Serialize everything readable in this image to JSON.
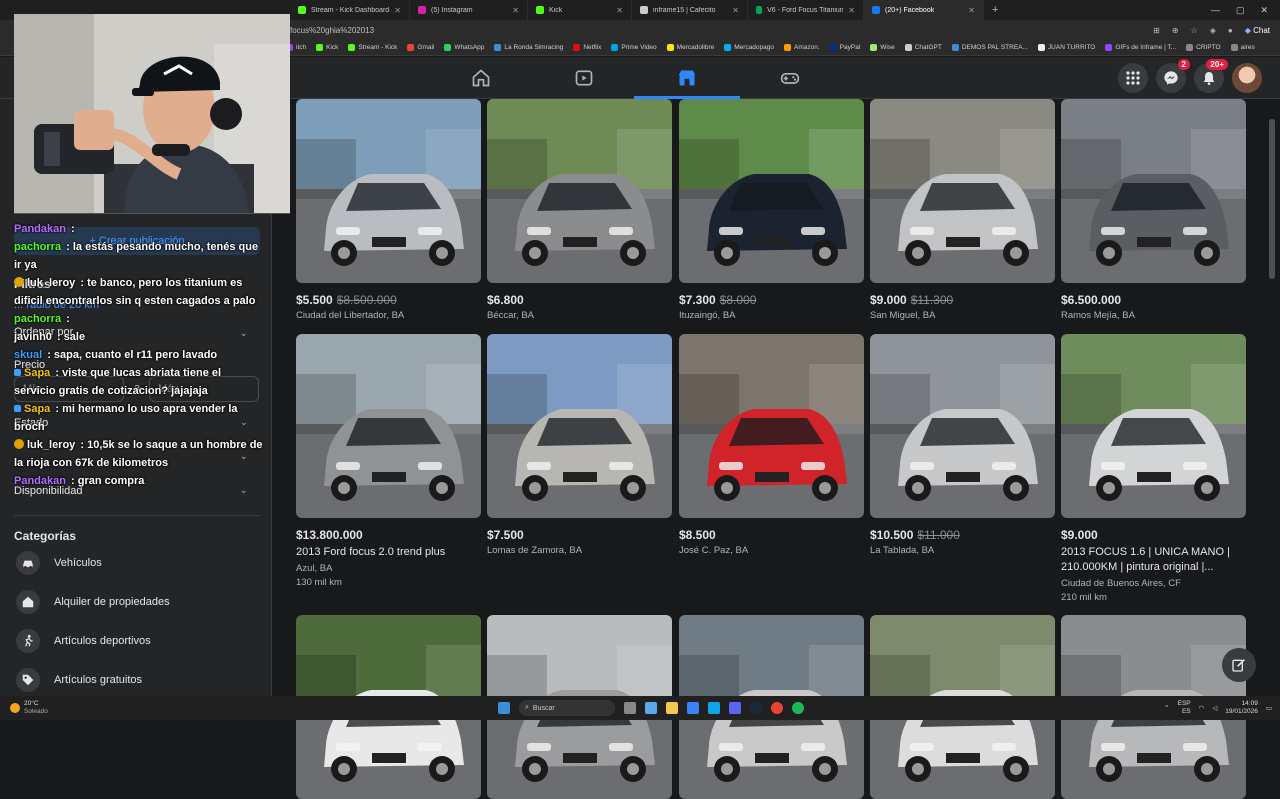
{
  "tabs": [
    {
      "label": "Stream - Kick Dashboard",
      "color": "#53fc18"
    },
    {
      "label": "(5) Instagram",
      "color": "#d6249f"
    },
    {
      "label": "Kick",
      "color": "#53fc18"
    },
    {
      "label": "inframe15 | Cafecito",
      "color": "#cccccc"
    },
    {
      "label": "V6 - Ford Focus Titanium MT 5p",
      "color": "#00a650"
    },
    {
      "label": "(20+) Facebook",
      "color": "#1877f2"
    }
  ],
  "address_bar": {
    "url_fragment": "focus%20ghia%202013"
  },
  "bookmarks": [
    {
      "label": "itch",
      "color": "#9146ff"
    },
    {
      "label": "Kick",
      "color": "#53fc18"
    },
    {
      "label": "Stream - Kick",
      "color": "#53fc18"
    },
    {
      "label": "Gmail",
      "color": "#ea4335"
    },
    {
      "label": "WhatsApp",
      "color": "#25d366"
    },
    {
      "label": "La Ronda Simracing",
      "color": "#3a8fd8"
    },
    {
      "label": "Netflix",
      "color": "#e50914"
    },
    {
      "label": "Prime Video",
      "color": "#00a8e1"
    },
    {
      "label": "Mercadolibre",
      "color": "#ffe600"
    },
    {
      "label": "Mercadopago",
      "color": "#00b1ea"
    },
    {
      "label": "Amazon.",
      "color": "#ff9900"
    },
    {
      "label": "PayPal",
      "color": "#003087"
    },
    {
      "label": "Wise",
      "color": "#9fe870"
    },
    {
      "label": "ChatGPT",
      "color": "#cccccc"
    },
    {
      "label": "DEMOS PAL STREA...",
      "color": "#3a8fd8"
    },
    {
      "label": "JUAN TURRITO",
      "color": "#eeeeee"
    },
    {
      "label": "GIFs de Inframe | T...",
      "color": "#9146ff"
    },
    {
      "label": "CRIPTO",
      "color": "#888888"
    },
    {
      "label": "aires",
      "color": "#888888"
    }
  ],
  "messenger_badge": "2",
  "notifications_badge": "20+",
  "chrome_chat_label": "Chat",
  "sidebar": {
    "create_listing": "+ Crear publicación",
    "filters_heading": "Filtros",
    "radius_prefix": "...",
    "radius": "radio de 20 km",
    "sort_label": "Ordenar por",
    "price_label": "Precio",
    "min_placeholder": "Mín.",
    "to_word": "a",
    "max_placeholder": "Máx.",
    "state_label": "Estado",
    "availability_label": "Disponibilidad",
    "categories_heading": "Categorías",
    "categories": [
      {
        "label": "Vehículos",
        "icon": "car-icon"
      },
      {
        "label": "Alquiler de propiedades",
        "icon": "house-icon"
      },
      {
        "label": "Artículos deportivos",
        "icon": "runner-icon"
      },
      {
        "label": "Artículos gratuitos",
        "icon": "tag-icon"
      }
    ]
  },
  "chat": [
    {
      "user": "Pandakan",
      "color": "#b86bff",
      "text": ""
    },
    {
      "user": "pachorra",
      "color": "#53fc18",
      "text": "la estás pesando mucho, tenés que ir ya"
    },
    {
      "user": "luk_leroy",
      "color": "#ffffff",
      "badge": "mod",
      "text": "te banco, pero los titanium es dificil encontrarlos sin q esten cagados a palo"
    },
    {
      "user": "pachorra",
      "color": "#53fc18",
      "text": ""
    },
    {
      "user": "javinh0",
      "color": "#ffffff",
      "text": "sale"
    },
    {
      "user": "skual",
      "color": "#3aa0ff",
      "text": "sapa, cuanto el r11 pero lavado"
    },
    {
      "user": "Sapa",
      "color": "#f5c518",
      "badge": "kick",
      "text": "viste que lucas abriata tiene el servicio gratis de cotizacion? jajajaja"
    },
    {
      "user": "Sapa",
      "color": "#f5c518",
      "badge": "kick",
      "text": "mi hermano lo uso apra vender la broch"
    },
    {
      "user": "luk_leroy",
      "color": "#ffffff",
      "badge": "mod",
      "text": "10,5k se lo saque a un hombre de la rioja con 67k de kilometros"
    },
    {
      "user": "Pandakan",
      "color": "#b86bff",
      "text": "gran compra"
    }
  ],
  "listings": [
    {
      "price": "$5.500",
      "old_price": "$8.500.000",
      "title": "",
      "location": "Ciudad del Libertador, BA",
      "meta": "",
      "car_color": "#b9bcc0",
      "bg": "#7d9db8"
    },
    {
      "price": "$6.800",
      "old_price": "",
      "title": "",
      "location": "Béccar, BA",
      "meta": "",
      "car_color": "#8a8c8e",
      "bg": "#6e8a55"
    },
    {
      "price": "$7.300",
      "old_price": "$8.000",
      "title": "",
      "location": "Ituzaingó, BA",
      "meta": "",
      "car_color": "#1c2330",
      "bg": "#5f8b4a"
    },
    {
      "price": "$9.000",
      "old_price": "$11.300",
      "title": "",
      "location": "San Miguel, BA",
      "meta": "",
      "car_color": "#c2c3c4",
      "bg": "#8a8a82"
    },
    {
      "price": "$6.500.000",
      "old_price": "",
      "title": "",
      "location": "Ramos Mejía, BA",
      "meta": "",
      "car_color": "#5a5d61",
      "bg": "#7a7f86"
    },
    {
      "price": "$13.800.000",
      "old_price": "",
      "title": "2013 Ford focus 2.0 trend plus",
      "location": "Azul, BA",
      "meta": "130 mil km",
      "car_color": "#8f9396",
      "bg": "#9aa6ad"
    },
    {
      "price": "$7.500",
      "old_price": "",
      "title": "",
      "location": "Lomas de Zamora, BA",
      "meta": "",
      "car_color": "#b7b6b2",
      "bg": "#7d9bc2"
    },
    {
      "price": "$8.500",
      "old_price": "",
      "title": "",
      "location": "José C. Paz, BA",
      "meta": "",
      "car_color": "#d0242a",
      "bg": "#7b756b"
    },
    {
      "price": "$10.500",
      "old_price": "$11.000",
      "title": "",
      "location": "La Tablada, BA",
      "meta": "",
      "car_color": "#c6c8ca",
      "bg": "#8f949a"
    },
    {
      "price": "$9.000",
      "old_price": "",
      "title": "2013 FOCUS 1.6 | UNICA MANO | 210.000KM | pintura original |...",
      "location": "Ciudad de Buenos Aires, CF",
      "meta": "210 mil km",
      "car_color": "#d2d4d6",
      "bg": "#6f8d5c"
    },
    {
      "price": "",
      "old_price": "",
      "title": "",
      "location": "",
      "meta": "",
      "car_color": "#e8e8e8",
      "bg": "#4e6b3c"
    },
    {
      "price": "",
      "old_price": "",
      "title": "",
      "location": "",
      "meta": "",
      "car_color": "#9a9c9e",
      "bg": "#b9bcbf"
    },
    {
      "price": "",
      "old_price": "",
      "title": "",
      "location": "",
      "meta": "",
      "car_color": "#c9c9c9",
      "bg": "#6f7c86"
    },
    {
      "price": "",
      "old_price": "",
      "title": "",
      "location": "",
      "meta": "",
      "car_color": "#dcdcdc",
      "bg": "#7d8a6c"
    },
    {
      "price": "",
      "old_price": "",
      "title": "",
      "location": "",
      "meta": "",
      "car_color": "#b7b8ba",
      "bg": "#8a8c90"
    }
  ],
  "taskbar": {
    "temp": "20°C",
    "weather": "Soleado",
    "search": "Buscar",
    "lang": "ESP",
    "region": "ES",
    "time": "14:09",
    "date": "19/01/2026"
  }
}
